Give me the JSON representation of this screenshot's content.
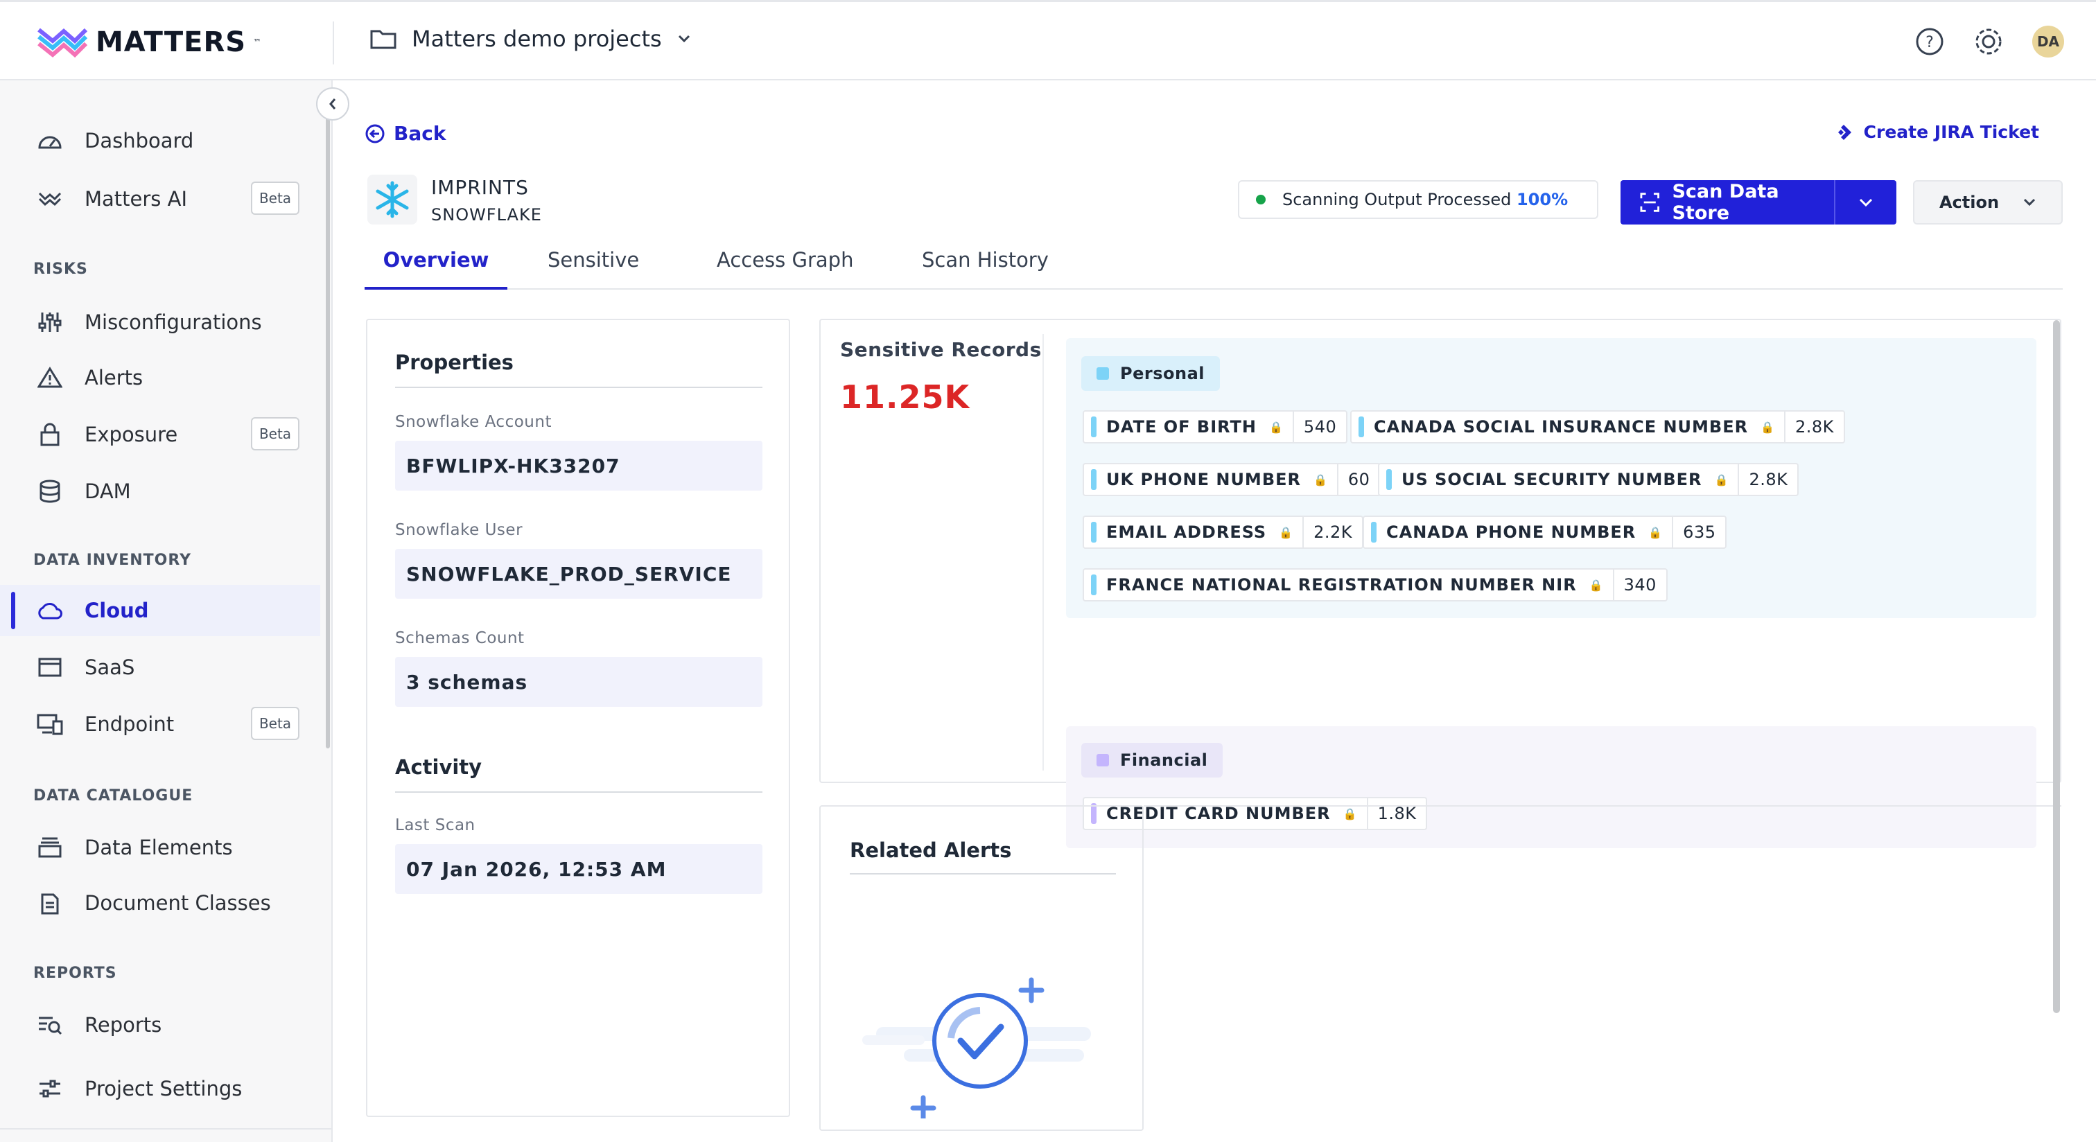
{
  "brand": {
    "name": "MATTERS",
    "tm": "™"
  },
  "project": {
    "name": "Matters demo projects"
  },
  "user": {
    "initials": "DA"
  },
  "colors": {
    "accent": "#2222c9",
    "danger": "#dc2626",
    "personal": "#7dd3f7",
    "financial": "#c4b5fd"
  },
  "sidebar": {
    "items": [
      {
        "label": "Dashboard",
        "icon": "gauge-icon"
      },
      {
        "label": "Matters AI",
        "icon": "matters-logo-icon",
        "badge": "Beta"
      },
      {
        "label": "Misconfigurations",
        "icon": "sliders-icon"
      },
      {
        "label": "Alerts",
        "icon": "warning-icon"
      },
      {
        "label": "Exposure",
        "icon": "lock-icon",
        "badge": "Beta"
      },
      {
        "label": "DAM",
        "icon": "database-icon"
      },
      {
        "label": "Cloud",
        "icon": "cloud-icon",
        "active": true
      },
      {
        "label": "SaaS",
        "icon": "window-icon"
      },
      {
        "label": "Endpoint",
        "icon": "devices-icon",
        "badge": "Beta"
      },
      {
        "label": "Data Elements",
        "icon": "stack-icon"
      },
      {
        "label": "Document Classes",
        "icon": "document-icon"
      },
      {
        "label": "Reports",
        "icon": "report-search-icon"
      },
      {
        "label": "Project Settings",
        "icon": "settings-sliders-icon"
      }
    ],
    "sections": {
      "risks": "RISKS",
      "inventory": "DATA INVENTORY",
      "catalogue": "DATA CATALOGUE",
      "reports": "REPORTS"
    }
  },
  "header": {
    "back": "Back",
    "jira": "Create JIRA Ticket",
    "datastore_name": "IMPRINTS",
    "datastore_type": "SNOWFLAKE",
    "scan_status_label": "Scanning Output Processed",
    "scan_status_pct": "100%",
    "scan_button": "Scan Data Store",
    "action_button": "Action"
  },
  "tabs": [
    "Overview",
    "Sensitive",
    "Access Graph",
    "Scan History"
  ],
  "properties": {
    "title": "Properties",
    "fields": [
      {
        "label": "Snowflake Account",
        "value": "BFWLIPX-HK33207"
      },
      {
        "label": "Snowflake User",
        "value": "SNOWFLAKE_PROD_SERVICE"
      },
      {
        "label": "Schemas Count",
        "value": "3 schemas"
      }
    ],
    "activity_title": "Activity",
    "last_scan_label": "Last Scan",
    "last_scan_value": "07 Jan 2026, 12:53 AM"
  },
  "sensitive": {
    "title": "Sensitive Records",
    "count": "11.25K",
    "personal": {
      "label": "Personal",
      "tags": [
        {
          "name": "DATE OF BIRTH",
          "count": "540"
        },
        {
          "name": "CANADA SOCIAL INSURANCE NUMBER",
          "count": "2.8K"
        },
        {
          "name": "UK PHONE NUMBER",
          "count": "60"
        },
        {
          "name": "US SOCIAL SECURITY NUMBER",
          "count": "2.8K"
        },
        {
          "name": "EMAIL ADDRESS",
          "count": "2.2K"
        },
        {
          "name": "CANADA PHONE NUMBER",
          "count": "635"
        },
        {
          "name": "FRANCE NATIONAL REGISTRATION NUMBER NIR",
          "count": "340"
        }
      ]
    },
    "financial": {
      "label": "Financial",
      "tags": [
        {
          "name": "CREDIT CARD NUMBER",
          "count": "1.8K"
        }
      ]
    }
  },
  "related_alerts": {
    "title": "Related Alerts"
  }
}
